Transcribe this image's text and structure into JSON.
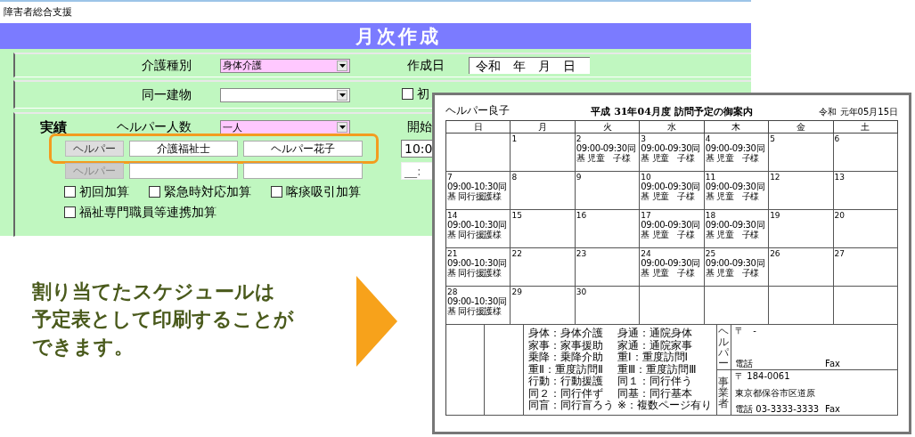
{
  "window": {
    "title": "障害者総合支援",
    "header": "月次作成"
  },
  "form": {
    "care_type": {
      "label": "介護種別",
      "value": "身体介護",
      "highlighted": true
    },
    "created_date": {
      "label": "作成日",
      "value": "令和　年　月　日"
    },
    "same_building": {
      "label": "同一建物",
      "highlighted": false
    },
    "first_visit_plan": {
      "label": "初",
      "checked": false
    },
    "record": {
      "title": "実績",
      "helper_count": {
        "label": "ヘルパー人数",
        "value": "一人",
        "highlighted": true
      },
      "start_time_label": "開始",
      "helpers": [
        {
          "button": "ヘルパー",
          "disabled": false,
          "qualification": "介護福祉士",
          "name": "ヘルパー花子",
          "time": "10:0",
          "highlighted": true
        },
        {
          "button": "ヘルパー",
          "disabled": true,
          "time": "__:",
          "highlighted": false
        }
      ],
      "addons": [
        {
          "label": "初回加算",
          "checked": false
        },
        {
          "label": "緊急時対応加算",
          "checked": false
        },
        {
          "label": "喀痰吸引加算",
          "checked": false
        },
        {
          "label": "福祉専門職員等連携加算",
          "checked": false
        }
      ]
    }
  },
  "callout": {
    "lines": [
      "割り当てたスケジュールは",
      "予定表として印刷することが",
      "できます。"
    ]
  },
  "schedule_document": {
    "helper": "ヘルパー良子",
    "title": "平成 31年04月度 訪問予定の御案内",
    "date": "令和 元年05月15日",
    "weekdays": [
      "日",
      "月",
      "火",
      "水",
      "木",
      "金",
      "土"
    ],
    "weeks": [
      {
        "kind": "first",
        "days": [
          {
            "day": "1"
          },
          {
            "day": "2",
            "entry": "09:00-09:30同基 児童　子様"
          },
          {
            "day": "3",
            "entry": "09:00-09:30同基 児童　子様"
          },
          {
            "day": "4",
            "entry": "09:00-09:30同基 児童　子様"
          },
          {
            "day": "5"
          },
          {
            "day": "6"
          }
        ]
      },
      {
        "kind": "full",
        "days": [
          {
            "day": "7",
            "entry": "09:00-10:30同基 同行援護様"
          },
          {
            "day": "8"
          },
          {
            "day": "9"
          },
          {
            "day": "10",
            "entry": "09:00-09:30同基 児童　子様"
          },
          {
            "day": "11",
            "entry": "09:00-09:30同基 児童　子様"
          },
          {
            "day": "12"
          },
          {
            "day": "13"
          }
        ]
      },
      {
        "kind": "full",
        "days": [
          {
            "day": "14",
            "entry": "09:00-10:30同基 同行援護様"
          },
          {
            "day": "15"
          },
          {
            "day": "16"
          },
          {
            "day": "17",
            "entry": "09:00-09:30同基 児童　子様"
          },
          {
            "day": "18",
            "entry": "09:00-09:30同基 児童　子様"
          },
          {
            "day": "19"
          },
          {
            "day": "20"
          }
        ]
      },
      {
        "kind": "full",
        "days": [
          {
            "day": "21",
            "entry": "09:00-10:30同基 同行援護様"
          },
          {
            "day": "22"
          },
          {
            "day": "23"
          },
          {
            "day": "24",
            "entry": "09:00-09:30同基 児童　子様"
          },
          {
            "day": "25",
            "entry": "09:00-09:30同基 児童　子様"
          },
          {
            "day": "26"
          },
          {
            "day": "27"
          }
        ]
      },
      {
        "days": [
          {
            "day": "28",
            "entry": "09:00-10:30同基 同行援護様"
          },
          {
            "day": "29"
          },
          {
            "day": "30"
          }
        ],
        "kind": "last"
      }
    ],
    "legend": [
      [
        "身体：身体介護",
        "身通：通院身体"
      ],
      [
        "家事：家事援助",
        "家通：通院家事"
      ],
      [
        "乗降：乗降介助",
        "重Ⅰ：重度訪問Ⅰ"
      ],
      [
        "重Ⅱ：重度訪問Ⅱ",
        "重Ⅲ：重度訪問Ⅲ"
      ],
      [
        "行動：行動援護",
        "同１：同行伴う"
      ],
      [
        "同２：同行伴ず",
        "同基：同行基本"
      ],
      [
        "同盲：同行盲ろう",
        "※：複数ページ有り"
      ]
    ],
    "contacts": [
      {
        "label": "ヘルパー",
        "postal": "〒　-",
        "phone": "電話",
        "fax": "Fax"
      },
      {
        "label": "事業者",
        "postal": "〒 184-0061",
        "address": "東京都保谷市区道原",
        "phone": "電話 03-3333-3333",
        "fax": "Fax"
      }
    ]
  }
}
